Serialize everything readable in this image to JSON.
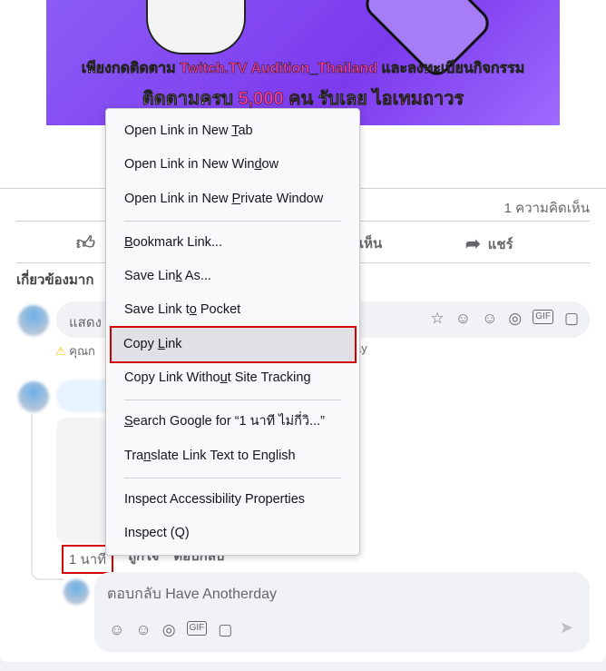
{
  "banner": {
    "line1_pre": "เพียงกดติดตาม ",
    "line1_brand": "Twitch.TV Audition_Thailand",
    "line1_post": " และลงทะเบียนกิจกรรม",
    "line2_pre": "ติดตามครบ ",
    "line2_count": "5,000 คน",
    "line2_mid": " รับเลย ",
    "line2_reward": "ไอเทมถาวร"
  },
  "post": {
    "comment_count": "1 ความคิดเห็น",
    "share_label": "แชร์",
    "comment_label_partial": "เห็น",
    "related_label": "เกี่ยวข้องมาก",
    "comment_placeholder": "แสดง",
    "warning_text": "คุณก",
    "warning_tail": "ay"
  },
  "comment": {
    "time": "1 นาที",
    "like": "ถูกใจ",
    "reply": "ตอบกลับ",
    "reply_placeholder": "ตอบกลับ Have Anotherday"
  },
  "menu": {
    "items": [
      {
        "pre": "Open Link in New ",
        "key": "T",
        "post": "ab"
      },
      {
        "pre": "Open Link in New Win",
        "key": "d",
        "post": "ow"
      },
      {
        "pre": "Open Link in New ",
        "key": "P",
        "post": "rivate Window"
      },
      {
        "pre": "",
        "key": "B",
        "post": "ookmark Link..."
      },
      {
        "pre": "Save Lin",
        "key": "k",
        "post": " As..."
      },
      {
        "pre": "Save Link t",
        "key": "o",
        "post": " Pocket"
      },
      {
        "pre": "Copy ",
        "key": "L",
        "post": "ink"
      },
      {
        "pre": "Copy Link Witho",
        "key": "u",
        "post": "t Site Tracking"
      },
      {
        "pre": "",
        "key": "S",
        "post": "earch Google for “1 นาที ไม่กี่วิ...”"
      },
      {
        "pre": "Tra",
        "key": "n",
        "post": "slate Link Text to English"
      },
      {
        "pre": "Inspect Accessibility Properties",
        "key": "",
        "post": ""
      },
      {
        "pre": "Inspect (Q)",
        "key": "",
        "post": ""
      }
    ]
  },
  "colors": {
    "highlight_border": "#d40000",
    "banner": "#8b5cf6"
  }
}
